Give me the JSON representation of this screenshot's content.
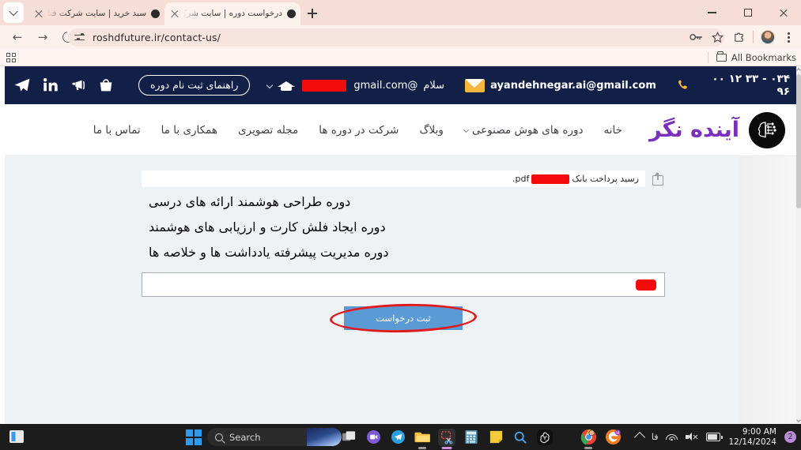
{
  "browser": {
    "tabs": [
      {
        "title": "سبد خرید | سایت شرکت فناور آیند",
        "active": false
      },
      {
        "title": "درخواست دوره | سایت شرکت فناو",
        "active": true
      }
    ],
    "new_tab_label": "+",
    "url": "roshdfuture.ir/contact-us/",
    "bookmarks_label": "All Bookmarks",
    "window_controls": {
      "minimize": "–",
      "maximize": "□",
      "close": "×"
    }
  },
  "site_topbar": {
    "phone": "۰۳۴ - ۳۳ ۱۲ ۰۰ ۹۶",
    "email": "ayandehnegar.ai@gmail.com",
    "greeting": "سلام",
    "user_email_suffix": "@gmail.com",
    "guide_button": "راهنمای ثبت نام دوره",
    "bar_color": "#122047",
    "envelope_color": "#f4b63f"
  },
  "navbar": {
    "brand": "آینده نگر",
    "menu": [
      {
        "label": "خانه",
        "has_dropdown": false
      },
      {
        "label": "دوره های هوش مصنوعی",
        "has_dropdown": true
      },
      {
        "label": "وبلاگ",
        "has_dropdown": false
      },
      {
        "label": "شرکت در دوره ها",
        "has_dropdown": false
      },
      {
        "label": "مجله تصویری",
        "has_dropdown": false
      },
      {
        "label": "همکاری با ما",
        "has_dropdown": false
      },
      {
        "label": "تماس با ما",
        "has_dropdown": false
      }
    ],
    "brand_color": "#7b2fbe"
  },
  "form": {
    "file_row": {
      "label": "رسید پرداخت بانک",
      "file_extension": ".pdf",
      "redacted": true
    },
    "checkboxes": [
      {
        "label": "دوره طراحی هوشمند ارائه های درسی",
        "checked": true
      },
      {
        "label": "دوره ایجاد فلش کارت و ارزیابی های هوشمند",
        "checked": false
      },
      {
        "label": "دوره مدیریت پیشرفته یادداشت ها و خلاصه ها",
        "checked": false
      }
    ],
    "message_field": {
      "value": "",
      "redacted": true
    },
    "submit_label": "ثبت درخواست",
    "submit_color": "#5b9bd5",
    "annotation_color": "#e01b1b"
  },
  "taskbar": {
    "search_placeholder": "Search",
    "language": "فا",
    "time": "9:00 AM",
    "date": "12/14/2024",
    "notification_count": "2",
    "apps": [
      "task-view",
      "chat",
      "telegram",
      "file-explorer",
      "snipping-tool",
      "calculator",
      "sticky-notes",
      "search",
      "chatgpt",
      "chrome",
      "browser-e"
    ]
  }
}
